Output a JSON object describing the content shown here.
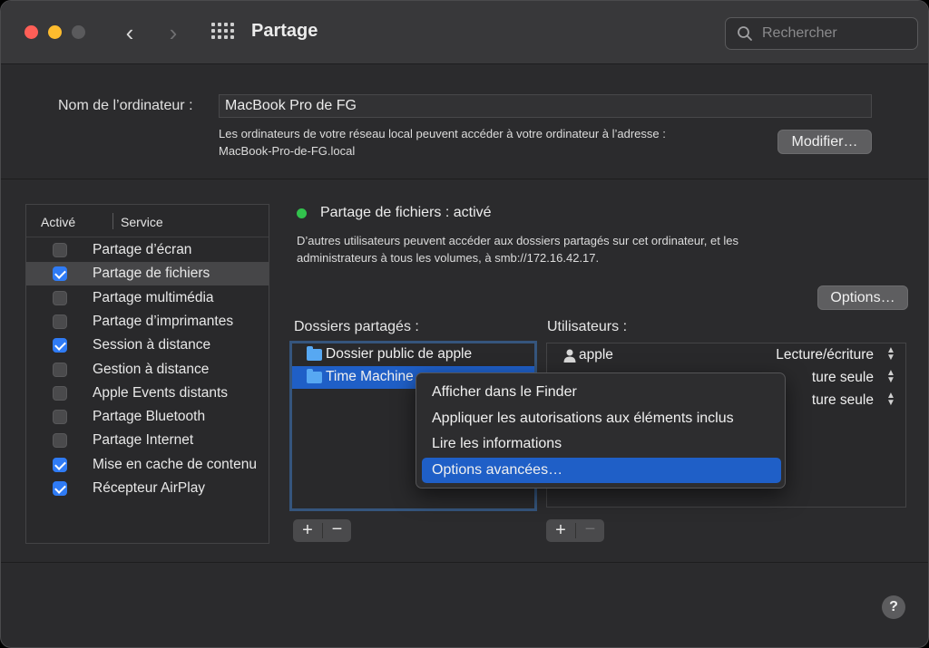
{
  "window": {
    "title": "Partage"
  },
  "search": {
    "placeholder": "Rechercher"
  },
  "computer_name": {
    "label": "Nom de l’ordinateur :",
    "value": "MacBook Pro de FG",
    "info_line1": "Les ordinateurs de votre réseau local peuvent accéder à votre ordinateur à l’adresse :",
    "info_line2": "MacBook-Pro-de-FG.local",
    "modify_button": "Modifier…"
  },
  "services": {
    "header_active": "Activé",
    "header_service": "Service",
    "items": [
      {
        "label": "Partage d’écran",
        "checked": false
      },
      {
        "label": "Partage de fichiers",
        "checked": true,
        "selected": true
      },
      {
        "label": "Partage multimédia",
        "checked": false
      },
      {
        "label": "Partage d’imprimantes",
        "checked": false
      },
      {
        "label": "Session à distance",
        "checked": true
      },
      {
        "label": "Gestion à distance",
        "checked": false
      },
      {
        "label": "Apple Events distants",
        "checked": false
      },
      {
        "label": "Partage Bluetooth",
        "checked": false
      },
      {
        "label": "Partage Internet",
        "checked": false
      },
      {
        "label": "Mise en cache de contenu",
        "checked": true
      },
      {
        "label": "Récepteur AirPlay",
        "checked": true
      }
    ]
  },
  "detail": {
    "status": "Partage de fichiers : activé",
    "status_color": "#32c24d",
    "desc_line1": "D’autres utilisateurs peuvent accéder aux dossiers partagés sur cet ordinateur, et les",
    "desc_line2": "administrateurs à tous les volumes, à smb://172.16.42.17.",
    "options_button": "Options…",
    "folders_label": "Dossiers partagés :",
    "users_label": "Utilisateurs :",
    "folders": [
      {
        "label": "Dossier public de apple"
      },
      {
        "label": "Time Machine"
      }
    ],
    "users": [
      {
        "name": "apple",
        "permission": "Lecture/écriture"
      },
      {
        "name": "",
        "permission": "ture seule"
      },
      {
        "name": "",
        "permission": "ture seule"
      }
    ],
    "plus": "+",
    "minus": "−"
  },
  "context_menu": {
    "items": [
      {
        "label": "Afficher dans le Finder"
      },
      {
        "label": "Appliquer les autorisations aux éléments inclus"
      },
      {
        "label": "Lire les informations"
      },
      {
        "label": "Options avancées…",
        "highlighted": true
      }
    ]
  },
  "help": {
    "label": "?"
  },
  "colors": {
    "accent": "#1f5fc7",
    "checkbox": "#2f7bf5"
  }
}
